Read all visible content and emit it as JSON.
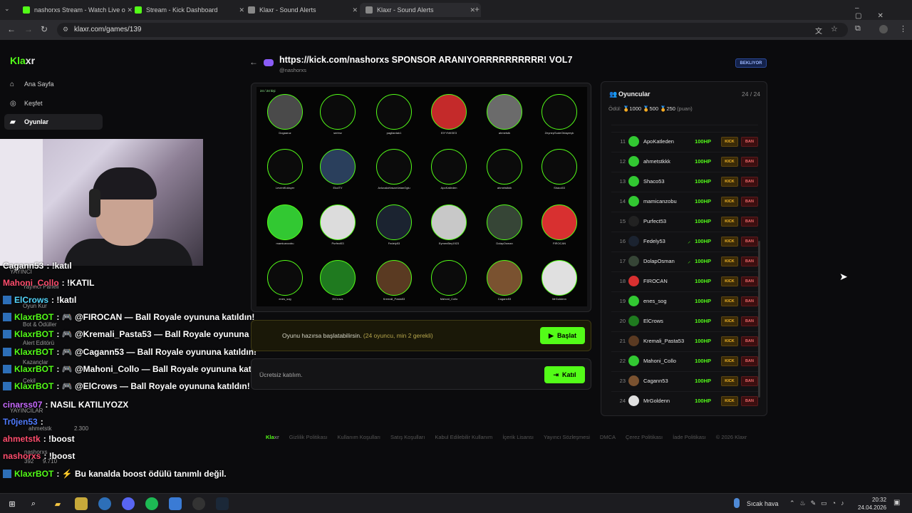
{
  "browser": {
    "tabs": [
      {
        "title": "nashorxs Stream - Watch Live o",
        "color": "#53fc18"
      },
      {
        "title": "Stream - Kick Dashboard",
        "color": "#53fc18"
      },
      {
        "title": "Klaxr - Sound Alerts",
        "color": "#888888"
      },
      {
        "title": "Klaxr - Sound Alerts",
        "color": "#888888"
      }
    ],
    "url": "klaxr.com/games/139"
  },
  "sidebar": {
    "logo_a": "Kla",
    "logo_b": "xr",
    "items": [
      {
        "label": "Ana Sayfa",
        "icon": "home-icon"
      },
      {
        "label": "Keşfet",
        "icon": "compass-icon"
      },
      {
        "label": "Oyunlar",
        "icon": "gamepad-icon"
      }
    ]
  },
  "chat": [
    {
      "user": "Cagann53",
      "text": ": !katıl",
      "color": "#ffffff"
    },
    {
      "user": "Mahoni_Collo",
      "text": ": !KATIL",
      "color": "#ff4d6d"
    },
    {
      "user": "ElCrows",
      "text": ": !katıl",
      "color": "#53d6fc"
    },
    {
      "user": "KlaxrBOT",
      "text": ": 🎮 @FIROCAN — Ball Royale oyununa katıldın!",
      "color": "#53fc18"
    },
    {
      "user": "KlaxrBOT",
      "text": ": 🎮 @Kremali_Pasta53 — Ball Royale oyununa katıldın!",
      "color": "#53fc18"
    },
    {
      "user": "KlaxrBOT",
      "text": ": 🎮 @Cagann53 — Ball Royale oyununa katıldın!",
      "color": "#53fc18"
    },
    {
      "user": "KlaxrBOT",
      "text": ": 🎮 @Mahoni_Collo — Ball Royale oyununa katıldın!",
      "color": "#53fc18"
    },
    {
      "user": "KlaxrBOT",
      "text": ": 🎮 @ElCrows — Ball Royale oyununa katıldın!",
      "color": "#53fc18"
    },
    {
      "user": "cinarss07",
      "text": ": NASIL KATILIYOZX",
      "color": "#c86bff"
    },
    {
      "user": "Tr0jen53",
      "text": ":",
      "color": "#4f7bff"
    },
    {
      "user": "ahmetstk",
      "text": ": !boost",
      "color": "#ff4d6d"
    },
    {
      "user": "nashorxs",
      "text": ": !boost",
      "color": "#ff4d6d"
    },
    {
      "user": "KlaxrBOT",
      "text": ": ⚡ Bu kanalda boost ödülü tanımlı değil.",
      "color": "#53fc18"
    }
  ],
  "ghost_menu": [
    "YAYINCI",
    "Yayıncı Paneli",
    "Oyun Kur",
    "Bot & Ödüller",
    "Alert Editörü",
    "Kazançlar",
    "Çekil",
    "YAYINCILAR",
    "ahmetstk",
    "2.300",
    "nashorxs",
    "392",
    "9.710"
  ],
  "game": {
    "title": "https://kick.com/nashorxs SPONSOR ARANIYORRRRRRRRRR! VOL7",
    "host": "@nashorxs",
    "status": "BEKLIYOR",
    "arena_count": "24 / 24 kişi",
    "start_msg": "Oyunu hazırsa başlatabilirsin.",
    "start_hint": "(24 oyuncu, min 2 gerekli)",
    "start_label": "Başlat",
    "join_msg": "Ücretsiz katılım.",
    "join_label": "Katıl",
    "arena_players": [
      {
        "name": "Dogaaruz",
        "color": "#4a4a4a"
      },
      {
        "name": "serimz",
        "color": "#0b0b0b"
      },
      {
        "name": "pagliardak1",
        "color": "#0b0b0b"
      },
      {
        "name": "ElYYNKSE3",
        "color": "#c42a2a"
      },
      {
        "name": "ahmetstk",
        "color": "#6b6b6b"
      },
      {
        "name": "ZeynepSudeOktayeryk",
        "color": "#0b0b0b"
      },
      {
        "name": "LeventKoksyer",
        "color": "#0b0b0b"
      },
      {
        "name": "EkolTV",
        "color": "#2a3f5c"
      },
      {
        "name": "AvluvalaHasanVatanOglu",
        "color": "#0b0b0b"
      },
      {
        "name": "ApoKatleden",
        "color": "#0b0b0b"
      },
      {
        "name": "ahmetstkkk",
        "color": "#0b0b0b"
      },
      {
        "name": "Shaco53",
        "color": "#0b0b0b"
      },
      {
        "name": "mamicanzobu",
        "color": "#32c832"
      },
      {
        "name": "Purfect53",
        "color": "#dcdcdc"
      },
      {
        "name": "Fedely53",
        "color": "#1b2330"
      },
      {
        "name": "EymenBey1923",
        "color": "#c8c8c8"
      },
      {
        "name": "DolapOsman",
        "color": "#364536"
      },
      {
        "name": "FIROCAN",
        "color": "#d83030"
      },
      {
        "name": "enes_sog",
        "color": "#0b0b0b"
      },
      {
        "name": "ElCrows",
        "color": "#1f7a1f"
      },
      {
        "name": "Kremali_Pasta53",
        "color": "#5a3a22"
      },
      {
        "name": "Mahoni_Collo",
        "color": "#0b0b0b"
      },
      {
        "name": "Cagann53",
        "color": "#7a5230"
      },
      {
        "name": "MrGoldenn",
        "color": "#e0e0e0"
      }
    ]
  },
  "players": {
    "title": "Oyuncular",
    "count": "24 / 24",
    "reward_label": "Ödül:",
    "rewards": [
      "1000",
      "500",
      "250"
    ],
    "reward_unit": "(puan)",
    "kick": "KICK",
    "ban": "BAN",
    "rows": [
      {
        "n": "11",
        "name": "ApoKatleden",
        "hp": "100HP",
        "c": "#32c832"
      },
      {
        "n": "12",
        "name": "ahmetstkkk",
        "hp": "100HP",
        "c": "#32c832"
      },
      {
        "n": "13",
        "name": "Shaco53",
        "hp": "100HP",
        "c": "#32c832"
      },
      {
        "n": "14",
        "name": "mamicanzobu",
        "hp": "100HP",
        "c": "#32c832"
      },
      {
        "n": "15",
        "name": "Purfect53",
        "hp": "100HP",
        "c": "#222222"
      },
      {
        "n": "16",
        "name": "Fedely53",
        "hp": "100HP",
        "c": "#1b2330",
        "sword": true
      },
      {
        "n": "17",
        "name": "DolapOsman",
        "hp": "100HP",
        "c": "#364536",
        "sword": true
      },
      {
        "n": "18",
        "name": "FIROCAN",
        "hp": "100HP",
        "c": "#d83030"
      },
      {
        "n": "19",
        "name": "enes_sog",
        "hp": "100HP",
        "c": "#32c832"
      },
      {
        "n": "20",
        "name": "ElCrows",
        "hp": "100HP",
        "c": "#1f7a1f"
      },
      {
        "n": "21",
        "name": "Kremali_Pasta53",
        "hp": "100HP",
        "c": "#5a3a22"
      },
      {
        "n": "22",
        "name": "Mahoni_Collo",
        "hp": "100HP",
        "c": "#32c832"
      },
      {
        "n": "23",
        "name": "Cagann53",
        "hp": "100HP",
        "c": "#7a5230"
      },
      {
        "n": "24",
        "name": "MrGoldenn",
        "hp": "100HP",
        "c": "#e0e0e0"
      }
    ]
  },
  "footer": [
    "Gizlilik Politikası",
    "Kullanım Koşulları",
    "Satış Koşulları",
    "Kabul Edilebilir Kullanım",
    "İçerik Lisansı",
    "Yayıncı Sözleşmesi",
    "DMCA",
    "Çerez Politikası",
    "İade Politikası",
    "© 2026 Klaxr"
  ],
  "taskbar": {
    "weather": "Sıcak hava",
    "time": "20:32",
    "date": "24.04.2026"
  }
}
